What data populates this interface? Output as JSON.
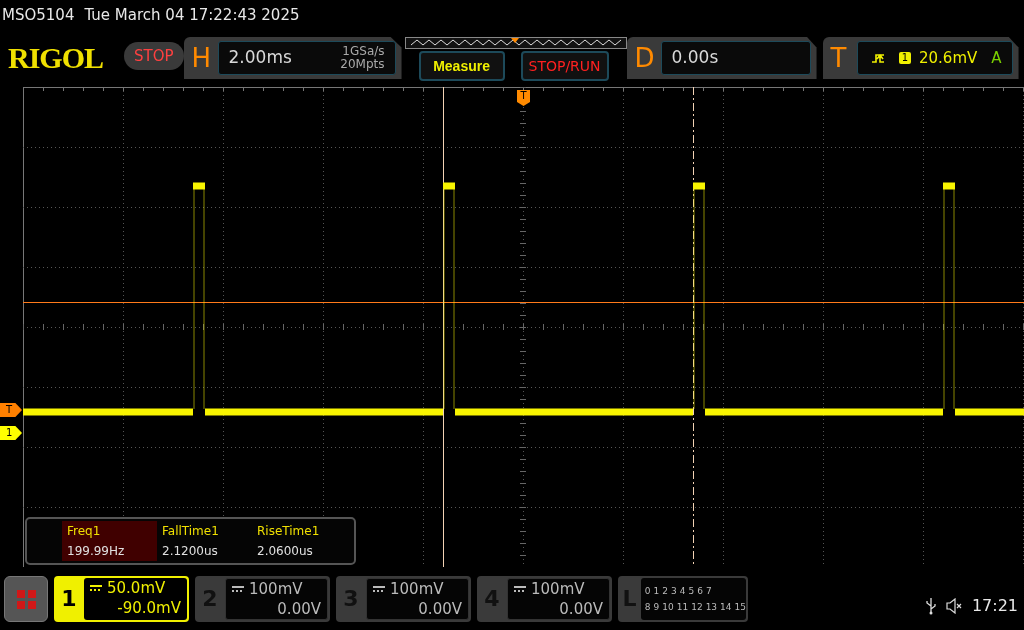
{
  "status_line": {
    "model": "MSO5104",
    "datetime": "Tue March 04 17:22:43 2025"
  },
  "header": {
    "logo": "RIGOL",
    "run_state": "STOP",
    "horizontal": {
      "label": "H",
      "timebase": "2.00ms",
      "sample_rate": "1GSa/s",
      "memory_depth": "20Mpts"
    },
    "buttons": [
      "Measure",
      "STOP/RUN"
    ],
    "delay": {
      "label": "D",
      "value": "0.00s"
    },
    "trigger": {
      "label": "T",
      "source": "1",
      "level": "20.6mV",
      "mode": "A"
    }
  },
  "screen": {
    "trigger_position_marker": "T",
    "markers": [
      {
        "label": "T",
        "color": "#ff8000"
      },
      {
        "label": "1",
        "color": "#ffff00"
      }
    ]
  },
  "measurements": [
    {
      "name": "Freq1",
      "value": "199.99Hz",
      "selected": true
    },
    {
      "name": "FallTime1",
      "value": "2.1200us",
      "selected": false
    },
    {
      "name": "RiseTime1",
      "value": "2.0600us",
      "selected": false
    }
  ],
  "channels": [
    {
      "kind": "analog",
      "label": "1",
      "scale": "50.0mV",
      "offset": "-90.0mV",
      "active": true
    },
    {
      "kind": "analog",
      "label": "2",
      "scale": "100mV",
      "offset": "0.00V",
      "active": false
    },
    {
      "kind": "analog",
      "label": "3",
      "scale": "100mV",
      "offset": "0.00V",
      "active": false
    },
    {
      "kind": "analog",
      "label": "4",
      "scale": "100mV",
      "offset": "0.00V",
      "active": false
    },
    {
      "kind": "logic",
      "label": "L",
      "bits_low": [
        "0",
        "1",
        "2",
        "3",
        "4",
        "5",
        "6",
        "7"
      ],
      "bits_high": [
        "8",
        "9",
        "10",
        "11",
        "12",
        "13",
        "14",
        "15"
      ]
    }
  ],
  "status_bar": {
    "time": "17:21"
  }
}
